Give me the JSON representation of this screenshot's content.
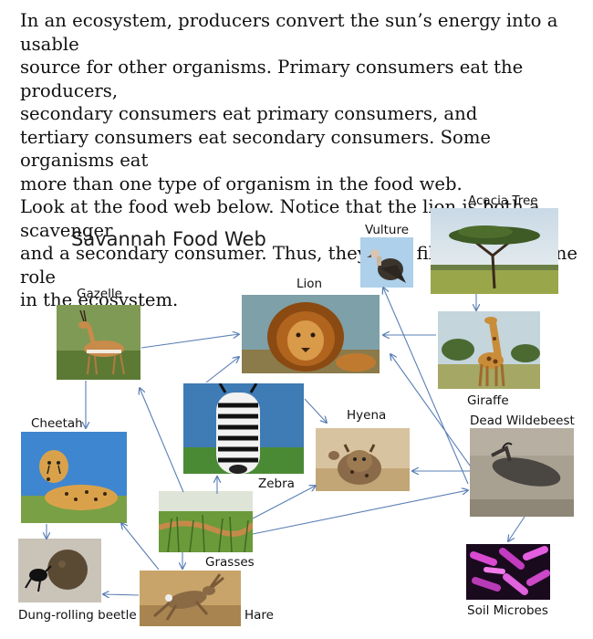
{
  "intro": {
    "lines": [
      "In an ecosystem, producers convert the sun’s energy into a usable",
      "source for other organisms. Primary consumers eat the producers,",
      "secondary consumers eat primary consumers, and",
      "tertiary consumers eat secondary consumers. Some organisms eat",
      "more than one type of organism in the food web.",
      "Look at the food web below. Notice that the lion is both a scavenger",
      "and a secondary consumer. Thus, they may fill more than one role",
      "in the ecosystem."
    ]
  },
  "diagram": {
    "title": "Savannah Food Web",
    "nodes": {
      "acacia": "Acacia Tree",
      "vulture": "Vulture",
      "lion": "Lion",
      "gazelle": "Gazelle",
      "giraffe": "Giraffe",
      "dead_wildebeest": "Dead Wildebeest",
      "hyena": "Hyena",
      "cheetah": "Cheetah",
      "zebra": "Zebra",
      "grasses": "Grasses",
      "dung_beetle": "Dung-rolling beetle",
      "hare": "Hare",
      "soil_microbes": "Soil Microbes"
    },
    "arrows": [
      {
        "from": "Acacia Tree",
        "to": "Giraffe"
      },
      {
        "from": "Giraffe",
        "to": "Lion"
      },
      {
        "from": "Dead Wildebeest",
        "to": "Lion"
      },
      {
        "from": "Dead Wildebeest",
        "to": "Vulture"
      },
      {
        "from": "Dead Wildebeest",
        "to": "Hyena"
      },
      {
        "from": "Dead Wildebeest",
        "to": "Soil Microbes"
      },
      {
        "from": "Gazelle",
        "to": "Lion"
      },
      {
        "from": "Gazelle",
        "to": "Cheetah"
      },
      {
        "from": "Zebra",
        "to": "Lion"
      },
      {
        "from": "Zebra",
        "to": "Hyena"
      },
      {
        "from": "Grasses",
        "to": "Zebra"
      },
      {
        "from": "Grasses",
        "to": "Gazelle"
      },
      {
        "from": "Grasses",
        "to": "Hyena"
      },
      {
        "from": "Grasses",
        "to": "Dead Wildebeest"
      },
      {
        "from": "Grasses",
        "to": "Hare"
      },
      {
        "from": "Hare",
        "to": "Cheetah"
      },
      {
        "from": "Hare",
        "to": "Dung-rolling beetle"
      },
      {
        "from": "Cheetah",
        "to": "Dung-rolling beetle"
      }
    ],
    "arrow_color": "#5a7fb5"
  }
}
